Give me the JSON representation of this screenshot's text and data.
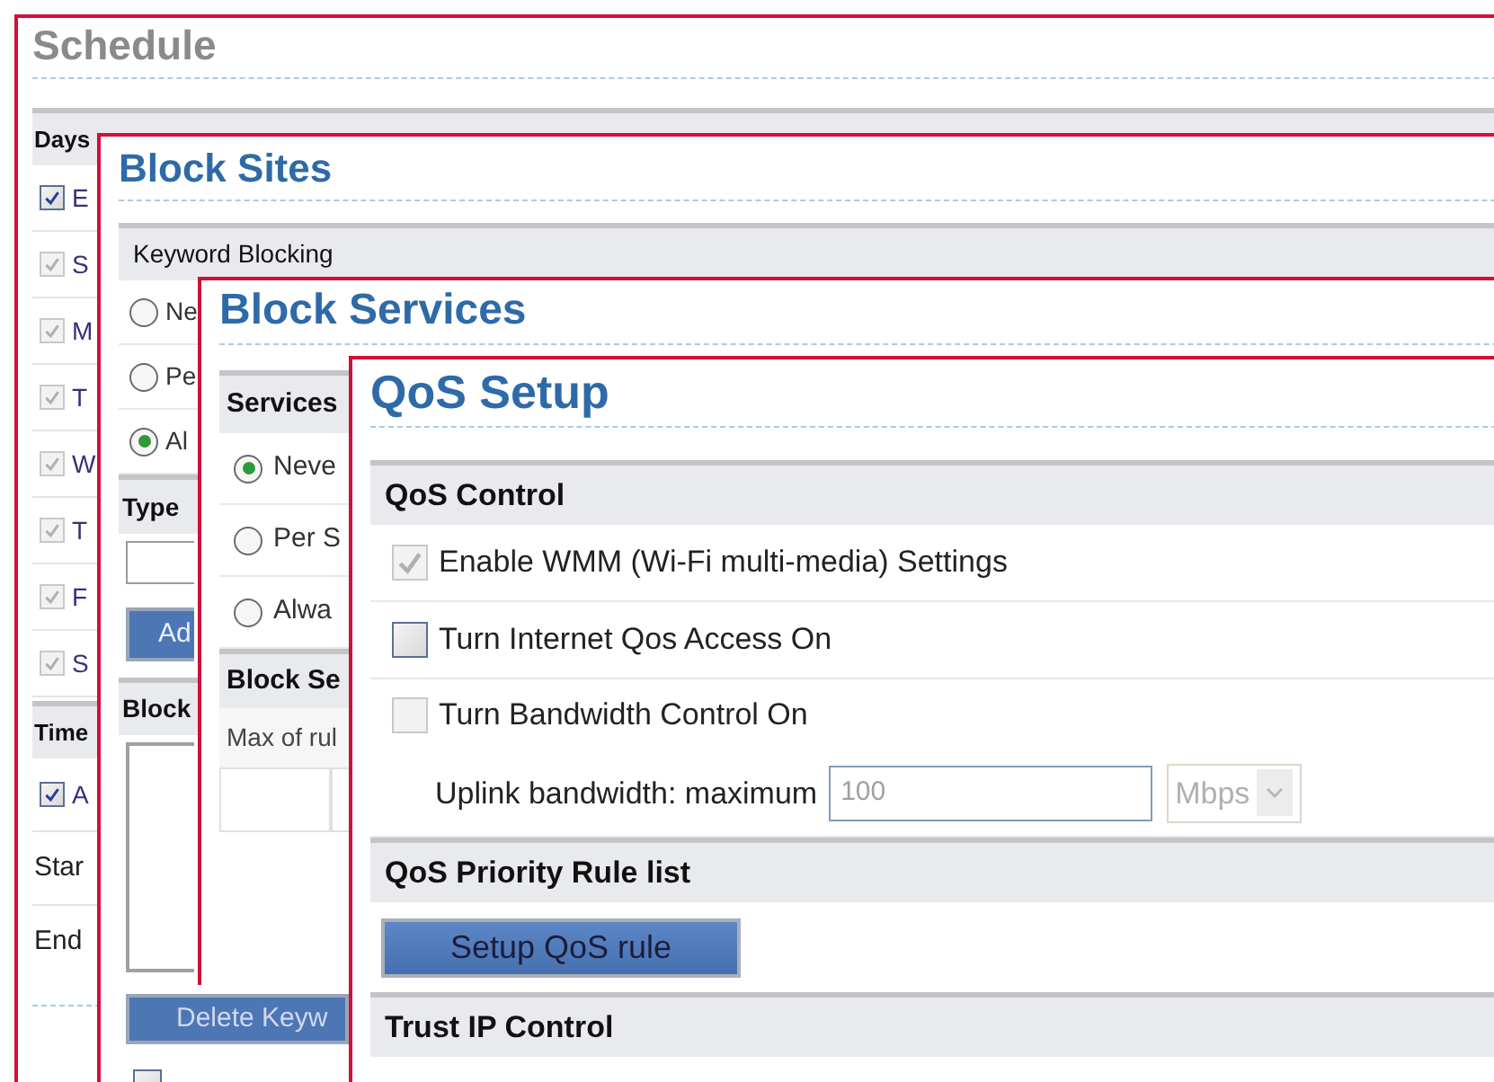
{
  "schedule": {
    "title": "Schedule",
    "days_header": "Days",
    "days": [
      {
        "label": "E",
        "checked": true,
        "disabled": false
      },
      {
        "label": "S",
        "checked": true,
        "disabled": true
      },
      {
        "label": "M",
        "checked": true,
        "disabled": true
      },
      {
        "label": "T",
        "checked": true,
        "disabled": true
      },
      {
        "label": "W",
        "checked": true,
        "disabled": true
      },
      {
        "label": "T",
        "checked": true,
        "disabled": true
      },
      {
        "label": "F",
        "checked": true,
        "disabled": true
      },
      {
        "label": "S",
        "checked": true,
        "disabled": true
      }
    ],
    "time_header": "Time",
    "all_day": {
      "label": "A",
      "checked": true
    },
    "start_label": "Star",
    "end_label": "End"
  },
  "block_sites": {
    "title": "Block Sites",
    "keyword_header": "Keyword Blocking",
    "options": [
      {
        "label": "Ne",
        "selected": false
      },
      {
        "label": "Pe",
        "selected": false
      },
      {
        "label": "Al",
        "selected": true
      }
    ],
    "type_header": "Type",
    "add_button": "Ad",
    "list_header": "Block",
    "delete_button": "Delete Keyw",
    "trusted": {
      "checked": false
    }
  },
  "block_services": {
    "title": "Block Services",
    "services_header": "Services",
    "options": [
      {
        "label": "Neve",
        "selected": true
      },
      {
        "label": "Per S",
        "selected": false
      },
      {
        "label": "Alwa",
        "selected": false
      }
    ],
    "table_header": "Block Se",
    "max_label": "Max of rul"
  },
  "qos": {
    "title": "QoS Setup",
    "control_header": "QoS Control",
    "options": [
      {
        "label": "Enable WMM (Wi-Fi multi-media) Settings",
        "checked": true,
        "disabled": true
      },
      {
        "label": "Turn Internet Qos Access On",
        "checked": false,
        "disabled": false
      },
      {
        "label": "Turn Bandwidth Control On",
        "checked": false,
        "disabled": true
      }
    ],
    "uplink": {
      "label": "Uplink bandwidth: maximum",
      "value": "100",
      "unit": "Mbps",
      "disabled": true
    },
    "priority_header": "QoS Priority Rule list",
    "setup_button": "Setup QoS rule",
    "trust_header": "Trust IP Control"
  }
}
